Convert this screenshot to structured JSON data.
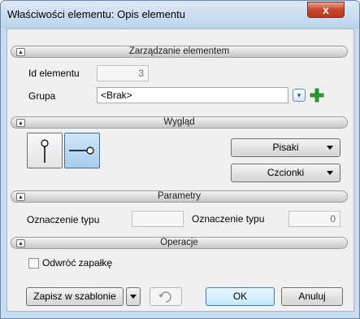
{
  "window": {
    "title": "Właściwości elementu: Opis elementu",
    "close_label": "x"
  },
  "sections": {
    "management": "Zarządzanie elementem",
    "appearance": "Wygląd",
    "parameters": "Parametry",
    "operations": "Operacje"
  },
  "management": {
    "id_label": "Id elementu",
    "id_value": "3",
    "group_label": "Grupa",
    "group_value": "<Brak>"
  },
  "appearance": {
    "pens_label": "Pisaki",
    "fonts_label": "Czcionki",
    "selected_option": "horizontal"
  },
  "parameters": {
    "type_label_1": "Oznaczenie typu",
    "type_value_1": "",
    "type_label_2": "Oznaczenie typu",
    "type_value_2": "0"
  },
  "operations": {
    "reverse_label": "Odwróć zapałkę",
    "reverse_checked": false
  },
  "footer": {
    "save_template_label": "Zapisz w szablonie",
    "ok_label": "OK",
    "cancel_label": "Anuluj"
  },
  "icons": [
    "close-icon",
    "collapse-icon",
    "pick-icon",
    "add-icon",
    "vertical-marker-icon",
    "horizontal-marker-icon",
    "dropdown-arrow-icon",
    "undo-icon",
    "checkbox-icon"
  ],
  "colors": {
    "title_bar": "#c9dbee",
    "close_button": "#c7462a",
    "add_green": "#2aa02a",
    "focus_border": "#3c7fb1"
  }
}
